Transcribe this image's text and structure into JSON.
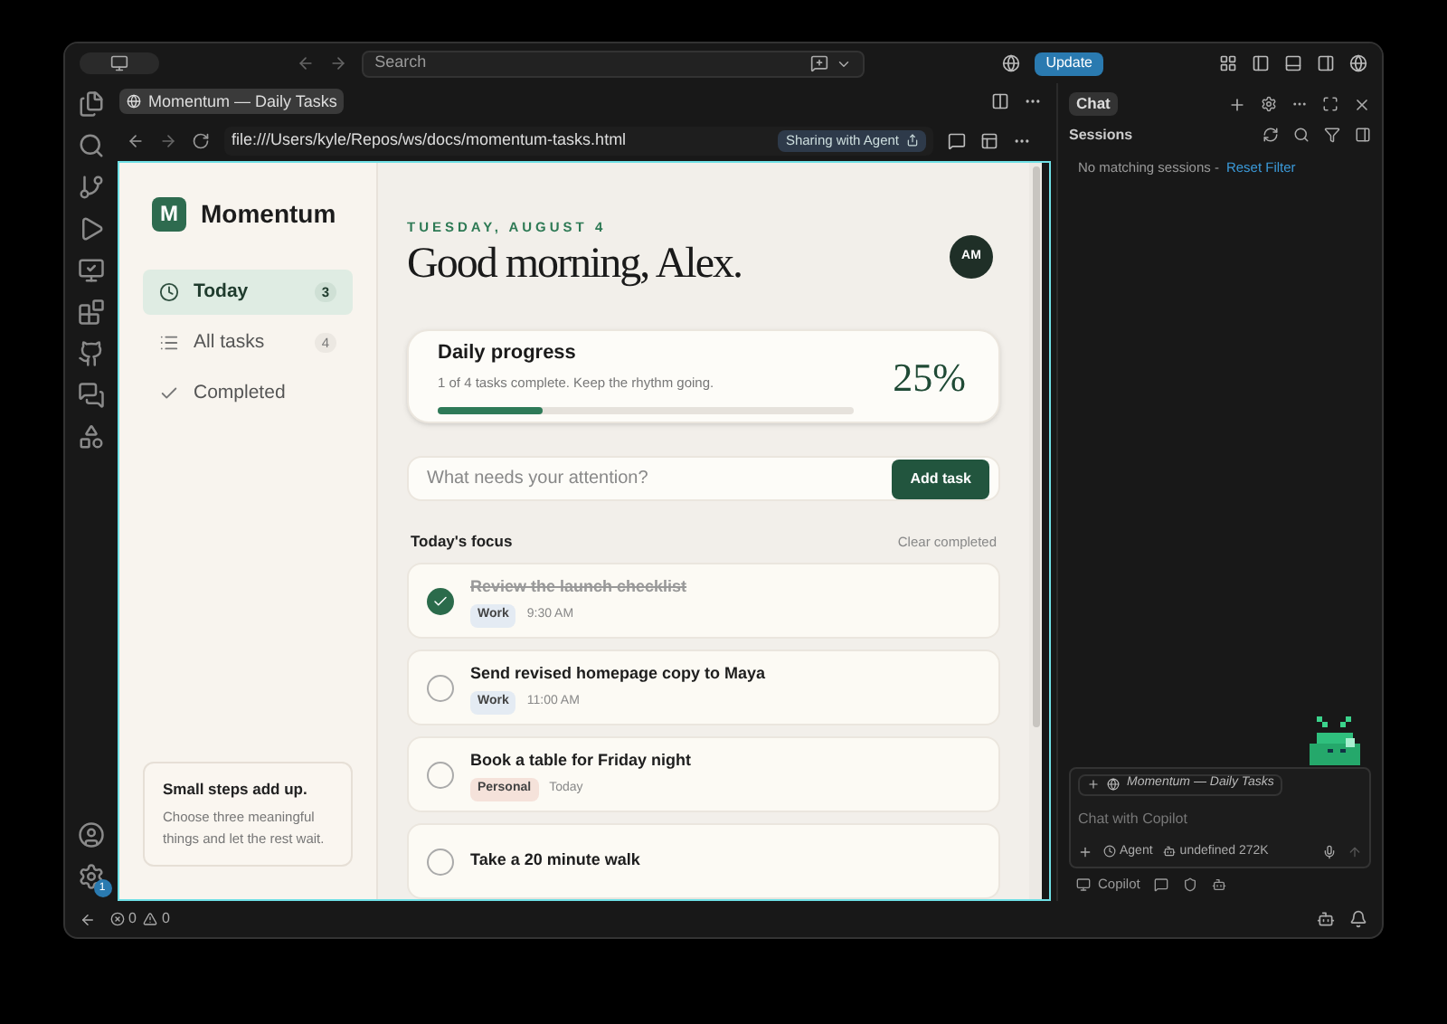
{
  "title_bar": {
    "search_placeholder": "Search",
    "update_button": "Update"
  },
  "editor_tab": {
    "title": "Momentum — Daily Tasks"
  },
  "browser": {
    "url": "file:///Users/kyle/Repos/ws/docs/momentum-tasks.html",
    "sharing_badge": "Sharing with Agent"
  },
  "app": {
    "logo_letter": "M",
    "brand": "Momentum",
    "nav": [
      {
        "kind": "clock",
        "label": "Today",
        "count": "3",
        "selected": true
      },
      {
        "kind": "list",
        "label": "All tasks",
        "count": "4",
        "selected": false
      },
      {
        "kind": "check",
        "label": "Completed",
        "selected": false
      }
    ],
    "tip": {
      "title": "Small steps add up.",
      "body": "Choose three meaningful things and let the rest wait."
    },
    "date": "TUESDAY, AUGUST 4",
    "greeting": "Good morning, Alex.",
    "avatar": "AM",
    "progress": {
      "title": "Daily progress",
      "subtitle": "1 of 4 tasks complete. Keep the rhythm going.",
      "level": 0.25,
      "percent": "25%"
    },
    "new_task": {
      "placeholder": "What needs your attention?",
      "button": "Add task"
    },
    "section_title": "Today's focus",
    "clear_link": "Clear completed",
    "tasks": [
      {
        "title": "Review the launch checklist",
        "tag": "Work",
        "color": "#e4ebf3",
        "time": "9:30 AM",
        "checked": true
      },
      {
        "title": "Send revised homepage copy to Maya",
        "tag": "Work",
        "color": "#e4ebf3",
        "time": "11:00 AM",
        "checked": false
      },
      {
        "title": "Book a table for Friday night",
        "tag": "Personal",
        "color": "#f5e2da",
        "time": "Today",
        "checked": false
      },
      {
        "title": "Take a 20 minute walk",
        "checked": false
      }
    ]
  },
  "chat": {
    "tab": "Chat",
    "sessions_title": "Sessions",
    "empty_text": "No matching sessions -",
    "reset_link": "Reset Filter",
    "context_chip": "Momentum — Daily Tasks",
    "input_placeholder": "Chat with Copilot",
    "mode": "Agent",
    "model": "undefined 272K",
    "footer_label": "Copilot"
  },
  "activity_bar": {
    "settings_badge": "1"
  },
  "status_bar": {
    "errors": "0",
    "warnings": "0"
  }
}
